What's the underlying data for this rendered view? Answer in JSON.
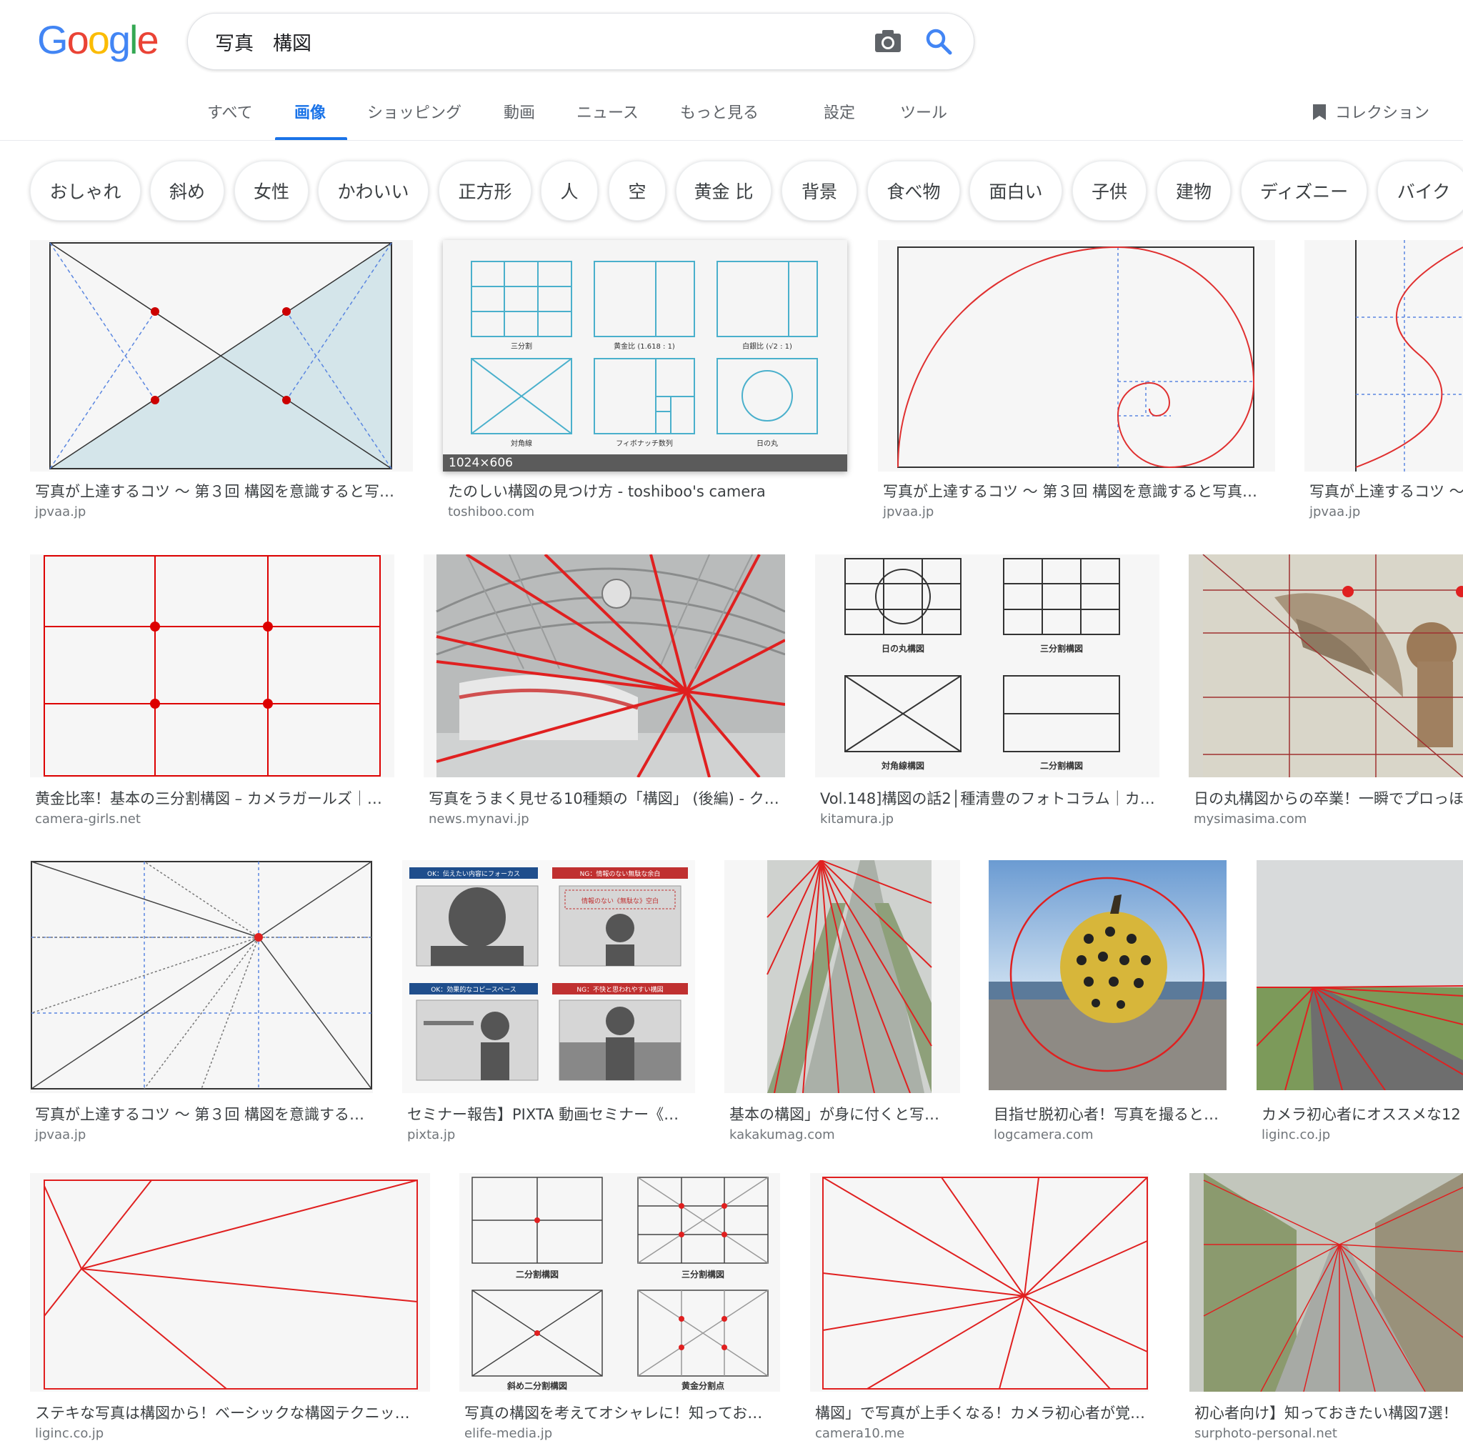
{
  "logo": [
    "G",
    "o",
    "o",
    "g",
    "l",
    "e"
  ],
  "search": {
    "query": "写真　構図"
  },
  "tabs": [
    "すべて",
    "画像",
    "ショッピング",
    "動画",
    "ニュース",
    "もっと見る",
    "設定",
    "ツール"
  ],
  "collection": "コレクション",
  "chips": [
    "おしゃれ",
    "斜め",
    "女性",
    "かわいい",
    "正方形",
    "人",
    "空",
    "黄金 比",
    "背景",
    "食べ物",
    "面白い",
    "子供",
    "建物",
    "ディズニー",
    "バイク"
  ],
  "results": [
    {
      "title": "写真が上達するコツ 〜 第３回 構図を意識すると写…",
      "source": "jpvaa.jp"
    },
    {
      "title": "たのしい構図の見つけ方 - toshiboo's camera",
      "source": "toshiboo.com",
      "dimensions": "1024×606"
    },
    {
      "title": "写真が上達するコツ 〜 第３回 構図を意識すると写真…",
      "source": "jpvaa.jp"
    },
    {
      "title": "写真が上達するコツ 〜",
      "source": "jpvaa.jp"
    },
    {
      "title": "黄金比率！基本の三分割構図 – カメラガールズ｜…",
      "source": "camera-girls.net"
    },
    {
      "title": "写真をうまく見せる10種類の「構図」 (後編) - ク…",
      "source": "news.mynavi.jp"
    },
    {
      "title": "Vol.148]構図の話2│種清豊のフォトコラム｜カ…",
      "source": "kitamura.jp"
    },
    {
      "title": "日の丸構図からの卒業！一瞬でプロっほ",
      "source": "mysimasima.com"
    },
    {
      "title": "写真が上達するコツ 〜 第３回 構図を意識する…",
      "source": "jpvaa.jp"
    },
    {
      "title": "セミナー報告】PIXTA 動画セミナー《…",
      "source": "pixta.jp"
    },
    {
      "title": "基本の構図」が身に付くと写…",
      "source": "kakakumag.com"
    },
    {
      "title": "目指せ脱初心者！写真を撮ると…",
      "source": "logcamera.com"
    },
    {
      "title": "カメラ初心者にオススメな12",
      "source": "liginc.co.jp"
    },
    {
      "title": "ステキな写真は構図から！ベーシックな構図テクニッ…",
      "source": "liginc.co.jp"
    },
    {
      "title": "写真の構図を考えてオシャレに！知ってお…",
      "source": "elife-media.jp"
    },
    {
      "title": "構図」で写真が上手くなる！カメラ初心者が覚…",
      "source": "camera10.me"
    },
    {
      "title": "初心者向け】知っておきたい構図7選！",
      "source": "surphoto-personal.net"
    }
  ],
  "labels": {
    "toshiboo": [
      "三分割",
      "黄金比 (1.618 : 1)",
      "白銀比 (√2 : 1)",
      "対角線",
      "フィボナッチ数列",
      "日の丸"
    ],
    "kitamura": [
      "日の丸構図",
      "三分割構図",
      "対角線構図",
      "二分割構図"
    ],
    "pixta": [
      "OK：伝えたい内容にフォーカス",
      "NG：情報のない無駄な余白",
      "情報のない《無駄な》空白",
      "OK：効果的なコピースペース",
      "NG：不快と思われやすい構図"
    ],
    "elife": [
      "二分割構図",
      "三分割構図",
      "斜め二分割構図",
      "黄金分割点"
    ]
  }
}
